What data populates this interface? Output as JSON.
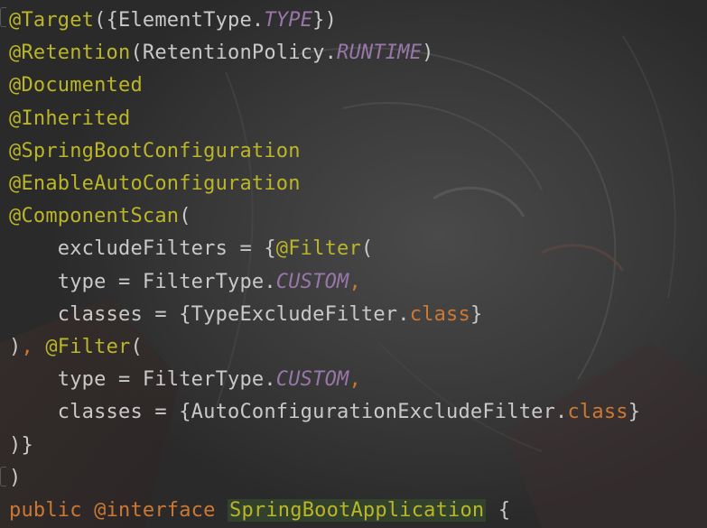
{
  "colors": {
    "background": "#2b2b2b",
    "annotation": "#bbb529",
    "keyword": "#cc7832",
    "constant": "#9876aa",
    "text": "#c9c9c9"
  },
  "editor": {
    "lines": [
      {
        "tokens": [
          {
            "t": "@Target",
            "c": "ann"
          },
          {
            "t": "({ElementType.",
            "c": "punc"
          },
          {
            "t": "TYPE",
            "c": "it"
          },
          {
            "t": "})",
            "c": "punc"
          }
        ]
      },
      {
        "tokens": [
          {
            "t": "@Retention",
            "c": "ann"
          },
          {
            "t": "(RetentionPolicy.",
            "c": "punc"
          },
          {
            "t": "RUNTIME",
            "c": "it"
          },
          {
            "t": ")",
            "c": "punc"
          }
        ]
      },
      {
        "tokens": [
          {
            "t": "@Documented",
            "c": "ann"
          }
        ]
      },
      {
        "tokens": [
          {
            "t": "@Inherited",
            "c": "ann"
          }
        ]
      },
      {
        "tokens": [
          {
            "t": "@SpringBootConfiguration",
            "c": "ann"
          }
        ]
      },
      {
        "tokens": [
          {
            "t": "@EnableAutoConfiguration",
            "c": "ann"
          }
        ]
      },
      {
        "tokens": [
          {
            "t": "@ComponentScan",
            "c": "ann"
          },
          {
            "t": "(",
            "c": "punc"
          }
        ]
      },
      {
        "tokens": [
          {
            "t": "    excludeFilters = {",
            "c": "punc"
          },
          {
            "t": "@Filter",
            "c": "ann"
          },
          {
            "t": "(",
            "c": "punc"
          }
        ]
      },
      {
        "tokens": [
          {
            "t": "    type = FilterType.",
            "c": "punc"
          },
          {
            "t": "CUSTOM",
            "c": "it"
          },
          {
            "t": ",",
            "c": "kw"
          }
        ]
      },
      {
        "tokens": [
          {
            "t": "    classes = {TypeExcludeFilter.",
            "c": "punc"
          },
          {
            "t": "class",
            "c": "kw"
          },
          {
            "t": "}",
            "c": "punc"
          }
        ]
      },
      {
        "tokens": [
          {
            "t": ")",
            "c": "punc"
          },
          {
            "t": ", ",
            "c": "kw"
          },
          {
            "t": "@Filter",
            "c": "ann"
          },
          {
            "t": "(",
            "c": "punc"
          }
        ]
      },
      {
        "tokens": [
          {
            "t": "    type = FilterType.",
            "c": "punc"
          },
          {
            "t": "CUSTOM",
            "c": "it"
          },
          {
            "t": ",",
            "c": "kw"
          }
        ]
      },
      {
        "tokens": [
          {
            "t": "    classes = {AutoConfigurationExcludeFilter.",
            "c": "punc"
          },
          {
            "t": "class",
            "c": "kw"
          },
          {
            "t": "}",
            "c": "punc"
          }
        ]
      },
      {
        "tokens": [
          {
            "t": ")}",
            "c": "punc"
          }
        ]
      },
      {
        "tokens": [
          {
            "t": ")",
            "c": "punc"
          }
        ]
      },
      {
        "tokens": [
          {
            "t": "public",
            "c": "kw"
          },
          {
            "t": " ",
            "c": "punc"
          },
          {
            "t": "@interface",
            "c": "kw"
          },
          {
            "t": " ",
            "c": "punc"
          },
          {
            "t": "SpringBootApplication",
            "c": "hl-class"
          },
          {
            "t": " {",
            "c": "punc"
          }
        ]
      }
    ]
  }
}
